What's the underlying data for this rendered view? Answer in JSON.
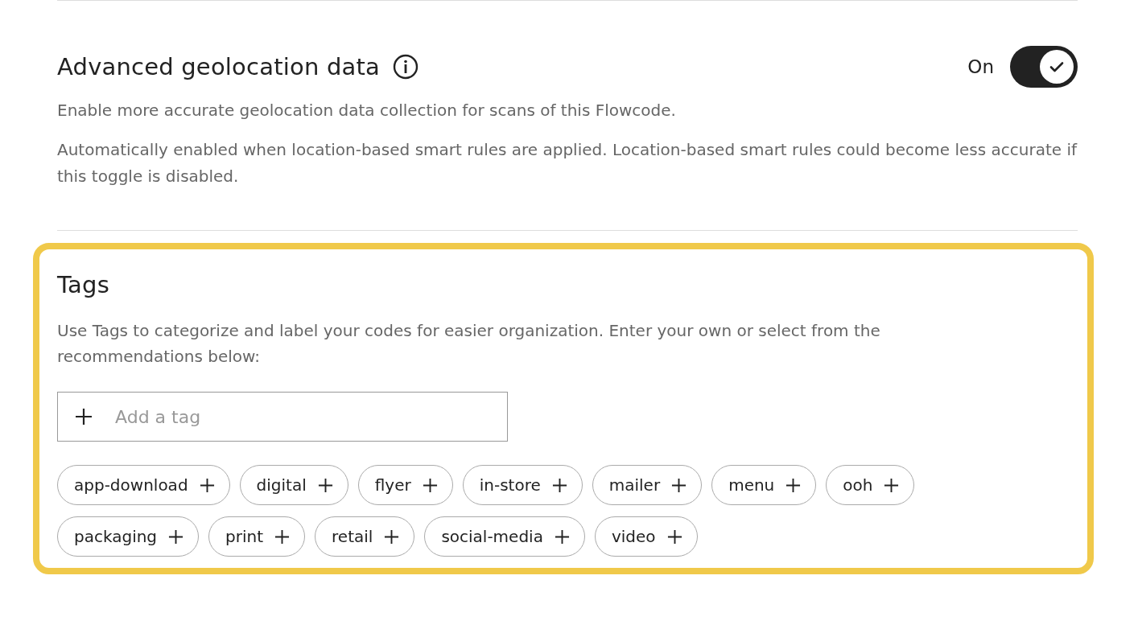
{
  "geolocation": {
    "title": "Advanced geolocation data",
    "toggle_label": "On",
    "on": true,
    "description": "Enable more accurate geolocation data collection for scans of this Flowcode.",
    "note": "Automatically enabled when location-based smart rules are applied. Location-based smart rules could become less accurate if this toggle is disabled."
  },
  "tags": {
    "title": "Tags",
    "description": "Use Tags to categorize and label your codes for easier organization. Enter your own or select from the recommendations below:",
    "input": {
      "placeholder": "Add a tag"
    },
    "suggestions": [
      "app-download",
      "digital",
      "flyer",
      "in-store",
      "mailer",
      "menu",
      "ooh",
      "packaging",
      "print",
      "retail",
      "social-media",
      "video"
    ]
  }
}
